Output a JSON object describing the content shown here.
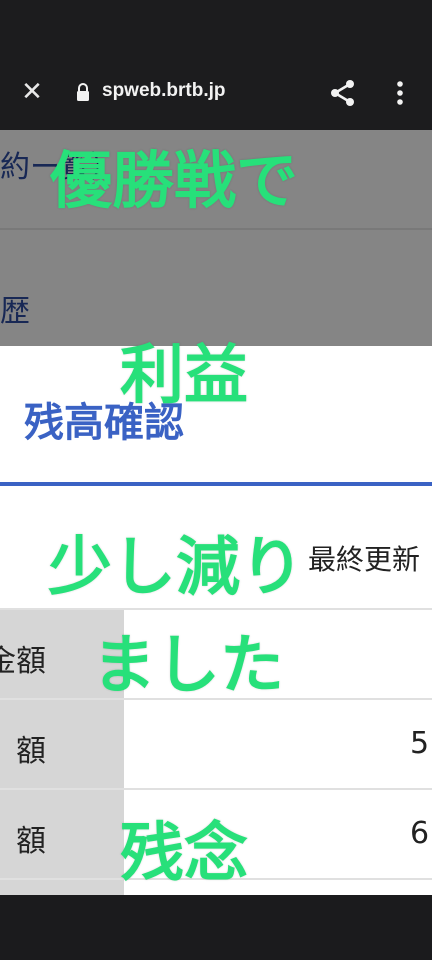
{
  "browser": {
    "url": "spweb.brtb.jp"
  },
  "nav": {
    "item1": "約ー覧）",
    "item2": "歴"
  },
  "main": {
    "section_title": "残高確認",
    "last_updated_label": "最終更新"
  },
  "table": {
    "rows": [
      {
        "label": "金額",
        "value": ""
      },
      {
        "label": "額",
        "value": "5"
      },
      {
        "label": "額",
        "value": "6"
      }
    ]
  },
  "captions": {
    "line1": "優勝戦で",
    "line2": "利益",
    "line3": "少し減り",
    "line4": "ました",
    "line5": "残念"
  },
  "colors": {
    "caption": "#27e07a",
    "accent": "#3a62c4"
  }
}
